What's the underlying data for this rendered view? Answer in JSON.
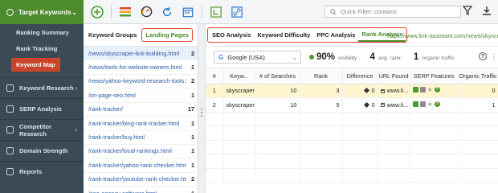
{
  "sidebar": {
    "header": "Target Keywords",
    "sub_items": [
      "Ranking Summary",
      "Rank Tracking",
      "Keyword Map"
    ],
    "active_sub": "Keyword Map",
    "items": [
      "Keyword Research",
      "SERP Analysis",
      "Competitor Research",
      "Domain Strength",
      "Reports"
    ],
    "header_color": "#4e8a2e",
    "highlight_color": "#e0452b"
  },
  "toolbar": {
    "quick_filter_placeholder": "Quick Filter: contains",
    "icons": [
      "add-icon",
      "list-icon",
      "gauge-icon",
      "refresh-icon",
      "calendar-icon",
      "sitemap-icon",
      "link-icon",
      "filter-icon",
      "download-icon"
    ]
  },
  "left_panel": {
    "tabs": [
      "Keyword Groups",
      "Landing Pages"
    ],
    "active_tab": "Landing Pages",
    "rows": [
      {
        "url": "/news/skyscraper-link-building.html",
        "count": "2"
      },
      {
        "url": "/news/tools-for-website-owners.html",
        "count": "1"
      },
      {
        "url": "/news/yahoo-keyword-research-tools.html",
        "count": "2"
      },
      {
        "url": "/on-page-seo.html",
        "count": "1"
      },
      {
        "url": "/rank-tracker/",
        "count": "17"
      },
      {
        "url": "/rank-tracker/bing-rank-tracker.html",
        "count": "1"
      },
      {
        "url": "/rank-tracker/buy.html",
        "count": "1"
      },
      {
        "url": "/rank-tracker/local-rankings.html",
        "count": "1"
      },
      {
        "url": "/rank-tracker/yahoo-rank-checker.html",
        "count": "1"
      },
      {
        "url": "/rank-tracker/youtube-rank-checker.html",
        "count": "2"
      },
      {
        "url": "/seo-agency-software.html",
        "count": "1"
      }
    ]
  },
  "right_panel": {
    "tabs": [
      "SEO Analysis",
      "Keyword Difficulty",
      "PPC Analysis",
      "Rank Analysis"
    ],
    "active_tab": "Rank Analysis",
    "url": "https://www.link-assistant.com/news/skyscra",
    "search_engine": "Google (USA)",
    "visibility_value": "90%",
    "visibility_label": "visibility",
    "avg_rank_value": "4",
    "avg_rank_label": "avg. rank",
    "organic_traffic_value": "1",
    "organic_traffic_label": "organic traffic",
    "columns": [
      "#",
      "Keyw...",
      "# of Searches",
      "Rank",
      "Difference",
      "URL Found",
      "SERP Features",
      "Organic Traffic"
    ],
    "rows": [
      {
        "n": "1",
        "keyword": "skyscraper",
        "searches": "10",
        "rank": "3",
        "difference": "0",
        "url": "www.li...",
        "traffic": "0"
      },
      {
        "n": "2",
        "keyword": "skyscraper",
        "searches": "10",
        "rank": "5",
        "difference": "0",
        "url": "www.li...",
        "traffic": "1"
      }
    ]
  }
}
